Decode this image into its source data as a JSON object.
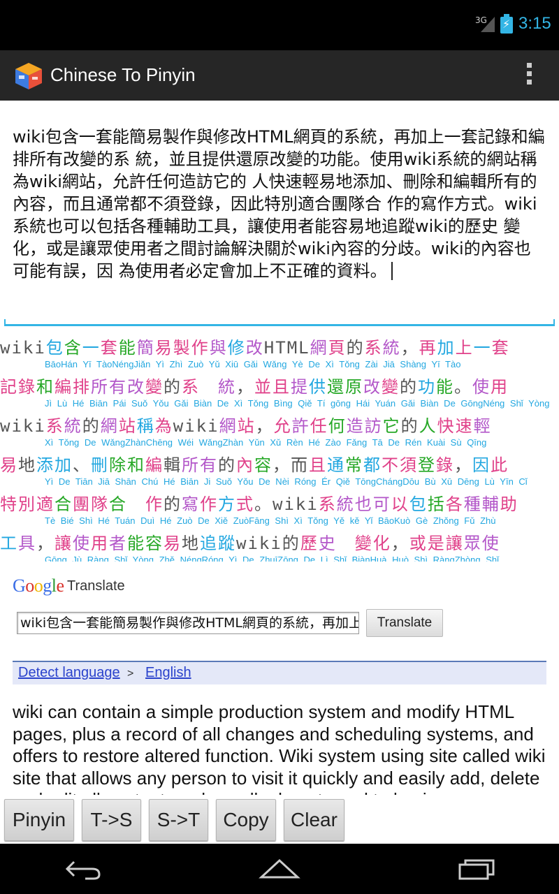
{
  "status_bar": {
    "network": "3G",
    "time": "3:15"
  },
  "action_bar": {
    "title": "Chinese To Pinyin",
    "icon": "app-cube-icon",
    "menu_icon": "overflow-menu-icon"
  },
  "input_text": "wiki包含一套能簡易製作與修改HTML網頁的系統，再加上一套記錄和編排所有改變的系 統，並且提供還原改變的功能。使用wiki系統的網站稱為wiki網站，允許任何造訪它的 人快速輕易地添加、刪除和編輯所有的內容，而且通常都不須登錄，因此特別適合團隊合 作的寫作方式。wiki系統也可以包括各種輔助工具，讓使用者能容易地追蹤wiki的歷史 變化，或是讓眾使用者之間討論解決關於wiki內容的分歧。wiki的內容也可能有誤，因 為使用者必定會加上不正確的資料。",
  "pinyin_rows": [
    {
      "chars": [
        [
          "wiki",
          "c5"
        ],
        [
          "包",
          "c1"
        ],
        [
          "含",
          "c3"
        ],
        [
          "一",
          "c1"
        ],
        [
          "套",
          "c2"
        ],
        [
          "能",
          "c3"
        ],
        [
          "簡",
          "c4"
        ],
        [
          "易",
          "c2"
        ],
        [
          "製",
          "c2"
        ],
        [
          "作",
          "c2"
        ],
        [
          "與",
          "c4"
        ],
        [
          "修",
          "c1"
        ],
        [
          "改",
          "c4"
        ],
        [
          "HTML",
          "c5"
        ],
        [
          "網",
          "c4"
        ],
        [
          "頁",
          "c2"
        ],
        [
          "的",
          "c5"
        ],
        [
          "系",
          "c2"
        ],
        [
          "統",
          "c4"
        ],
        [
          "，",
          "c5"
        ],
        [
          "再",
          "c2"
        ],
        [
          "加",
          "c1"
        ],
        [
          "上",
          "c2"
        ],
        [
          "一",
          "c1"
        ],
        [
          "套",
          "c2"
        ]
      ],
      "pinyin": "BāoHán Yī TàoNéngJiǎn Yì Zhì Zuò Yǔ Xiū Gǎi Wǎng Yè De Xì Tǒng Zài Jiā Shàng Yī Tào"
    },
    {
      "chars": [
        [
          "記",
          "c2"
        ],
        [
          "錄",
          "c2"
        ],
        [
          "和",
          "c3"
        ],
        [
          "編",
          "c2"
        ],
        [
          "排",
          "c2"
        ],
        [
          "所",
          "c4"
        ],
        [
          "有",
          "c4"
        ],
        [
          "改",
          "c4"
        ],
        [
          "變",
          "c2"
        ],
        [
          "的",
          "c5"
        ],
        [
          "系",
          "c2"
        ],
        [
          "　",
          "c5"
        ],
        [
          "統",
          "c4"
        ],
        [
          "，",
          "c5"
        ],
        [
          "並",
          "c2"
        ],
        [
          "且",
          "c2"
        ],
        [
          "提",
          "c4"
        ],
        [
          "供",
          "c1"
        ],
        [
          "還",
          "c3"
        ],
        [
          "原",
          "c3"
        ],
        [
          "改",
          "c4"
        ],
        [
          "變",
          "c2"
        ],
        [
          "的",
          "c5"
        ],
        [
          "功",
          "c1"
        ],
        [
          "能",
          "c3"
        ],
        [
          "。",
          "c5"
        ],
        [
          "使",
          "c4"
        ],
        [
          "用",
          "c2"
        ]
      ],
      "pinyin": "Jì Lù Hé Biān Pái Suǒ Yǒu Gǎi Biàn De Xì Tǒng Bìng Qiě Tí gōng Hái Yuán Gǎi Biàn De GōngNéng Shǐ Yòng"
    },
    {
      "chars": [
        [
          "wiki",
          "c5"
        ],
        [
          "系",
          "c2"
        ],
        [
          "統",
          "c4"
        ],
        [
          "的",
          "c5"
        ],
        [
          "網",
          "c4"
        ],
        [
          "站",
          "c2"
        ],
        [
          "稱",
          "c1"
        ],
        [
          "為",
          "c2"
        ],
        [
          "wiki",
          "c5"
        ],
        [
          "網",
          "c4"
        ],
        [
          "站",
          "c2"
        ],
        [
          "，",
          "c5"
        ],
        [
          "允",
          "c2"
        ],
        [
          "許",
          "c4"
        ],
        [
          "任",
          "c2"
        ],
        [
          "何",
          "c3"
        ],
        [
          "造",
          "c4"
        ],
        [
          "訪",
          "c4"
        ],
        [
          "它",
          "c3"
        ],
        [
          "的",
          "c5"
        ],
        [
          "人",
          "c3"
        ],
        [
          "快",
          "c2"
        ],
        [
          "速",
          "c2"
        ],
        [
          "輕",
          "c4"
        ]
      ],
      "pinyin": "Xì Tǒng De WǎngZhànChēng Wéi WǎngZhàn Yǔn Xǔ Rèn Hé Zào Fǎng Tā De Rén Kuài Sù Qīng"
    },
    {
      "chars": [
        [
          "易",
          "c2"
        ],
        [
          "地",
          "c5"
        ],
        [
          "添",
          "c1"
        ],
        [
          "加",
          "c1"
        ],
        [
          "、",
          "c5"
        ],
        [
          "刪",
          "c1"
        ],
        [
          "除",
          "c3"
        ],
        [
          "和",
          "c3"
        ],
        [
          "編",
          "c2"
        ],
        [
          "輯",
          "c5"
        ],
        [
          "所",
          "c4"
        ],
        [
          "有",
          "c4"
        ],
        [
          "的",
          "c5"
        ],
        [
          "內",
          "c2"
        ],
        [
          "容",
          "c3"
        ],
        [
          "，",
          "c5"
        ],
        [
          "而",
          "c5"
        ],
        [
          "且",
          "c2"
        ],
        [
          "通",
          "c1"
        ],
        [
          "常",
          "c3"
        ],
        [
          "都",
          "c1"
        ],
        [
          "不",
          "c2"
        ],
        [
          "須",
          "c2"
        ],
        [
          "登",
          "c3"
        ],
        [
          "錄",
          "c2"
        ],
        [
          "，",
          "c5"
        ],
        [
          "因",
          "c1"
        ],
        [
          "此",
          "c2"
        ]
      ],
      "pinyin": "Yì De Tiān Jiā Shān Chú Hé Biān Ji Suǒ Yǒu De Nèi Róng Ér Qiě TōngChángDōu Bù Xū Dēng Lù Yīn Cǐ"
    },
    {
      "chars": [
        [
          "特",
          "c2"
        ],
        [
          "別",
          "c2"
        ],
        [
          "適",
          "c2"
        ],
        [
          "合",
          "c3"
        ],
        [
          "團",
          "c2"
        ],
        [
          "隊",
          "c2"
        ],
        [
          "合",
          "c3"
        ],
        [
          "　",
          "c5"
        ],
        [
          "作",
          "c2"
        ],
        [
          "的",
          "c5"
        ],
        [
          "寫",
          "c4"
        ],
        [
          "作",
          "c2"
        ],
        [
          "方",
          "c1"
        ],
        [
          "式",
          "c2"
        ],
        [
          "。",
          "c5"
        ],
        [
          "wiki",
          "c5"
        ],
        [
          "系",
          "c2"
        ],
        [
          "統",
          "c4"
        ],
        [
          "也",
          "c4"
        ],
        [
          "可",
          "c4"
        ],
        [
          "以",
          "c2"
        ],
        [
          "包",
          "c1"
        ],
        [
          "括",
          "c3"
        ],
        [
          "各",
          "c2"
        ],
        [
          "種",
          "c4"
        ],
        [
          "輔",
          "c4"
        ],
        [
          "助",
          "c2"
        ]
      ],
      "pinyin": "Tè Bié Shì Hé Tuán Duì Hé Zuò De Xiě ZuòFāng Shì Xì Tǒng Yě kě Yǐ BāoKuò Gè Zhǒng Fǔ Zhù"
    },
    {
      "chars": [
        [
          "工",
          "c1"
        ],
        [
          "具",
          "c4"
        ],
        [
          "，",
          "c5"
        ],
        [
          "讓",
          "c2"
        ],
        [
          "使",
          "c4"
        ],
        [
          "用",
          "c2"
        ],
        [
          "者",
          "c4"
        ],
        [
          "能",
          "c3"
        ],
        [
          "容",
          "c3"
        ],
        [
          "易",
          "c2"
        ],
        [
          "地",
          "c5"
        ],
        [
          "追",
          "c1"
        ],
        [
          "蹤",
          "c1"
        ],
        [
          "wiki",
          "c5"
        ],
        [
          "的",
          "c5"
        ],
        [
          "歷",
          "c2"
        ],
        [
          "史",
          "c4"
        ],
        [
          "　",
          "c5"
        ],
        [
          "變",
          "c2"
        ],
        [
          "化",
          "c2"
        ],
        [
          "，",
          "c5"
        ],
        [
          "或",
          "c2"
        ],
        [
          "是",
          "c2"
        ],
        [
          "讓",
          "c2"
        ],
        [
          "眾",
          "c4"
        ],
        [
          "使",
          "c4"
        ]
      ],
      "pinyin": "Gōng Jù Ràng Shǐ Yòng Zhě NéngRóng Yì De ZhuīZōng De Lì Shǐ BiànHuà Huò Shì RàngZhòng Shǐ"
    }
  ],
  "translate_widget": {
    "logo": "Google",
    "label": "Translate",
    "input_value": "wiki包含一套能簡易製作與修改HTML網頁的系統，再加上一套記錄和編排所有改變的系統",
    "button": "Translate",
    "detect_link": "Detect language",
    "arrow": ">",
    "target_link": "English"
  },
  "translation_result": "wiki can contain a simple production system and modify HTML pages, plus a record of all changes and scheduling systems, and offers to restore altered function. Wiki system using site called wiki site that allows any person to visit it quickly and easily add, delete and edit all content, and usually do not need to log in",
  "buttons": [
    "Pinyin",
    "T->S",
    "S->T",
    "Copy",
    "Clear"
  ],
  "nav": {
    "back": "back-icon",
    "home": "home-icon",
    "recents": "recent-apps-icon"
  }
}
